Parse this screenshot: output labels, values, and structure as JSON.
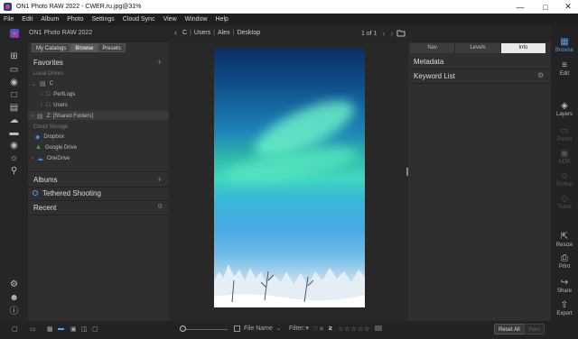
{
  "window": {
    "title": "ON1 Photo RAW 2022 - CWER.ru.jpg@31%",
    "controls": [
      "minimize-icon",
      "maximize-icon",
      "close-icon"
    ]
  },
  "menu": [
    "File",
    "Edit",
    "Album",
    "Photo",
    "Settings",
    "Cloud Sync",
    "View",
    "Window",
    "Help"
  ],
  "app": {
    "name": "ON1 Photo RAW 2022"
  },
  "breadcrumb": {
    "parts": [
      "C",
      "Users",
      "Alex",
      "Desktop"
    ]
  },
  "pager": {
    "text": "1 of 1"
  },
  "left_panel": {
    "tabs": [
      "My Catalogs",
      "Browse",
      "Presets"
    ],
    "active_tab": "Browse",
    "favorites": {
      "title": "Favorites"
    },
    "local_drives": {
      "label": "Local Drives",
      "items": [
        {
          "label": "C",
          "indent": 0
        },
        {
          "label": "PerfLogs",
          "indent": 1
        },
        {
          "label": "Users",
          "indent": 1
        },
        {
          "label": "Z: [Shared Folders]",
          "indent": 0
        }
      ]
    },
    "cloud_storage": {
      "label": "Cloud Storage",
      "items": [
        "Dropbox",
        "Google Drive",
        "OneDrive"
      ]
    },
    "albums": {
      "title": "Albums"
    },
    "tethered": {
      "title": "Tethered Shooting"
    },
    "recent": {
      "title": "Recent"
    }
  },
  "right_panel": {
    "tabs": [
      "Nav",
      "Levels",
      "Info"
    ],
    "active_tab": "Info",
    "sections": [
      "Metadata",
      "Keyword List"
    ]
  },
  "modules": {
    "top": [
      {
        "label": "Browse",
        "state": "active"
      },
      {
        "label": "Edit",
        "state": "normal"
      }
    ],
    "middle": [
      {
        "label": "Layers",
        "state": "normal"
      },
      {
        "label": "Paren",
        "state": "dim"
      },
      {
        "label": "HDR",
        "state": "dim"
      },
      {
        "label": "Portrai",
        "state": "dim"
      },
      {
        "label": "Trans",
        "state": "dim"
      }
    ],
    "bottom": [
      {
        "label": "Resize",
        "state": "normal"
      },
      {
        "label": "Print",
        "state": "normal"
      },
      {
        "label": "Share",
        "state": "normal"
      },
      {
        "label": "Export",
        "state": "normal"
      }
    ]
  },
  "bottom_bar": {
    "sort_label": "File Name",
    "filter_label": "Filter:",
    "reset_all": "Reset All",
    "sync": "Sync"
  },
  "colors": {
    "accent": "#4fa3e8",
    "panel": "#2f2f2f",
    "background": "#282828"
  }
}
